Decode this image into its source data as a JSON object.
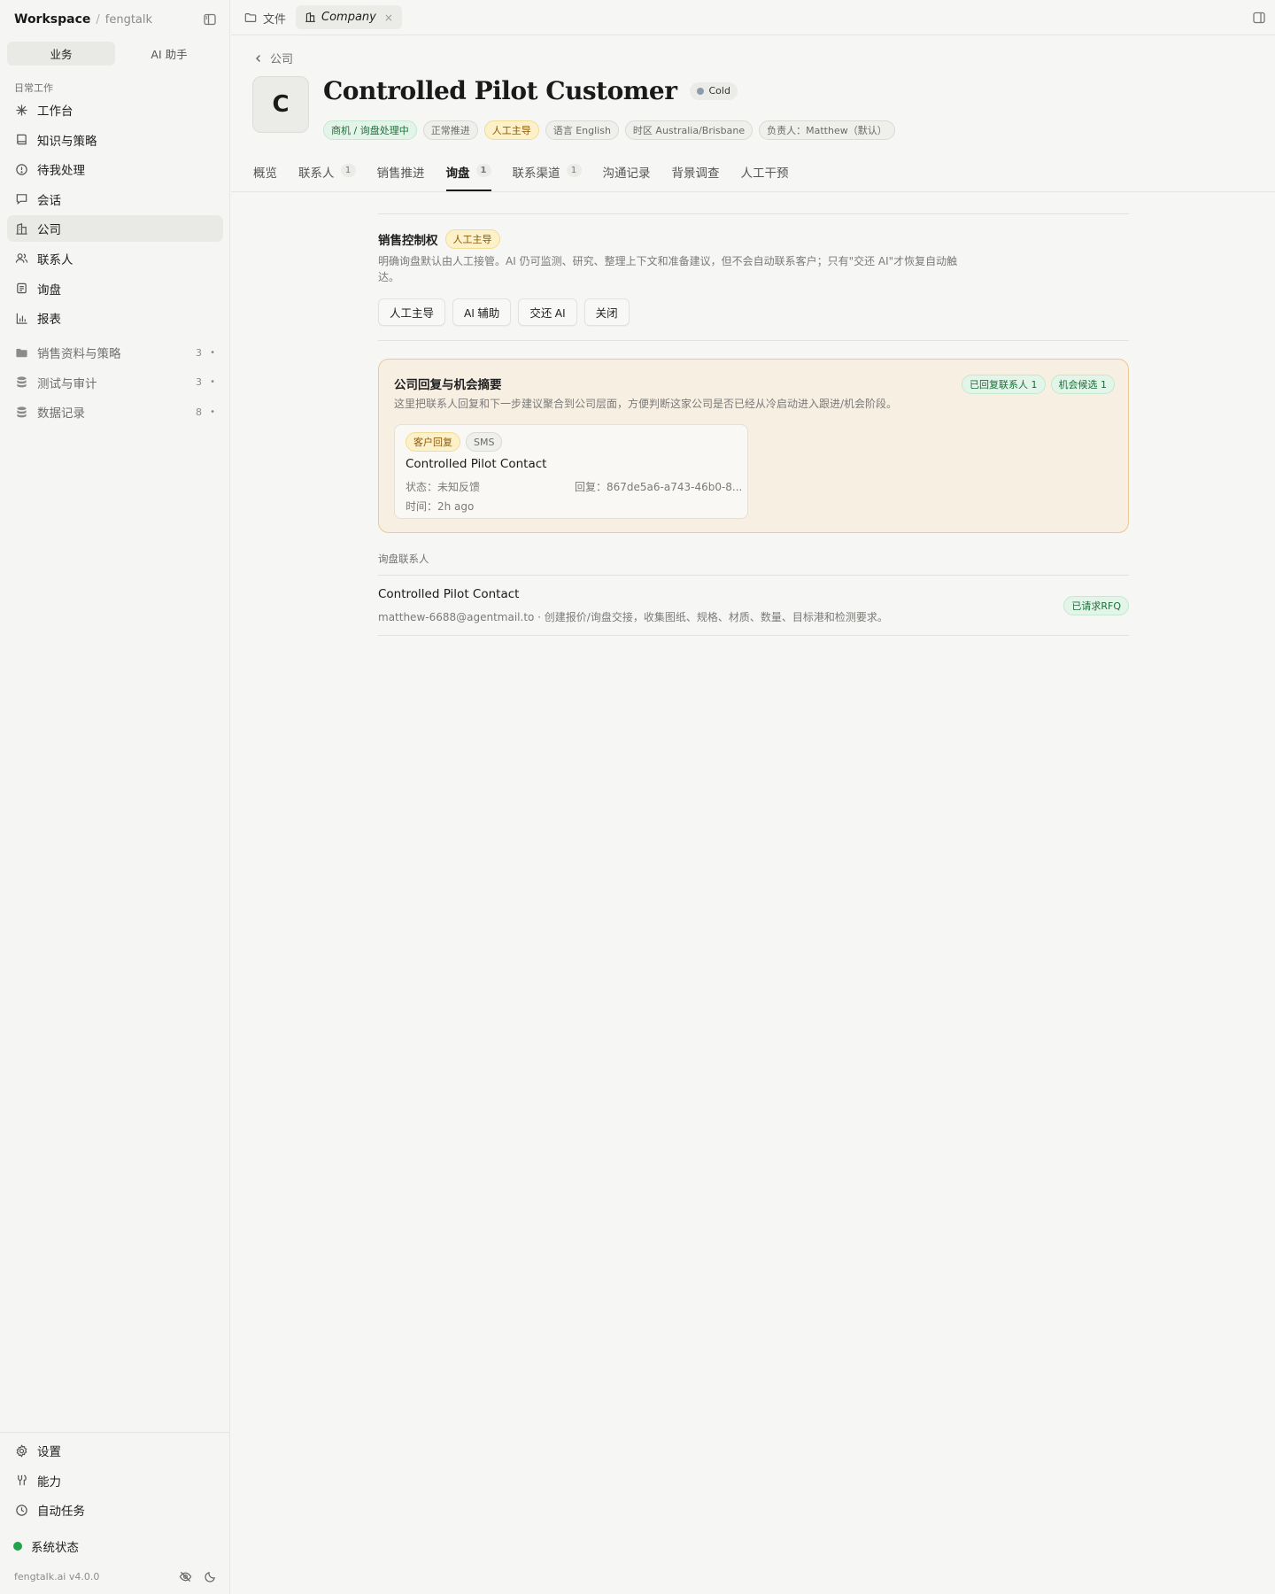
{
  "sidebar": {
    "workspace": "Workspace",
    "separator": "/",
    "org": "fengtalk",
    "segments": [
      "业务",
      "AI 助手"
    ],
    "section_label": "日常工作",
    "items": [
      {
        "label": "工作台",
        "icon": "sparkle-icon"
      },
      {
        "label": "知识与策略",
        "icon": "book-icon"
      },
      {
        "label": "待我处理",
        "icon": "alert-circle-icon"
      },
      {
        "label": "会话",
        "icon": "chat-icon"
      },
      {
        "label": "公司",
        "icon": "building-icon"
      },
      {
        "label": "联系人",
        "icon": "users-icon"
      },
      {
        "label": "询盘",
        "icon": "clipboard-icon"
      },
      {
        "label": "报表",
        "icon": "bar-chart-icon"
      }
    ],
    "folders": [
      {
        "label": "销售资料与策略",
        "count": "3",
        "icon": "folder-icon"
      },
      {
        "label": "测试与审计",
        "count": "3",
        "icon": "database-icon"
      },
      {
        "label": "数据记录",
        "count": "8",
        "icon": "database-icon"
      }
    ],
    "bottom": [
      {
        "label": "设置",
        "icon": "gear-icon"
      },
      {
        "label": "能力",
        "icon": "tools-icon"
      },
      {
        "label": "自动任务",
        "icon": "clock-icon"
      }
    ],
    "system_status": "系统状态",
    "version": "fengtalk.ai v4.0.0"
  },
  "topbar": {
    "files_tab": "文件",
    "company_tab": "Company",
    "close": "×"
  },
  "company": {
    "back": "公司",
    "avatar_letter": "C",
    "name": "Controlled Pilot Customer",
    "status": "Cold",
    "chips": [
      "商机 / 询盘处理中",
      "正常推进",
      "人工主导",
      "语言 English",
      "时区 Australia/Brisbane",
      "负责人：Matthew（默认）"
    ]
  },
  "tabs": [
    {
      "label": "概览",
      "count": ""
    },
    {
      "label": "联系人",
      "count": "1"
    },
    {
      "label": "销售推进",
      "count": ""
    },
    {
      "label": "询盘",
      "count": "1"
    },
    {
      "label": "联系渠道",
      "count": "1"
    },
    {
      "label": "沟通记录",
      "count": ""
    },
    {
      "label": "背景调查",
      "count": ""
    },
    {
      "label": "人工干预",
      "count": ""
    }
  ],
  "sales_control": {
    "title": "销售控制权",
    "badge": "人工主导",
    "description": "明确询盘默认由人工接管。AI 仍可监测、研究、整理上下文和准备建议，但不会自动联系客户；只有\"交还 AI\"才恢复自动触达。",
    "buttons": [
      "人工主导",
      "AI 辅助",
      "交还 AI",
      "关闭"
    ]
  },
  "summary": {
    "title": "公司回复与机会摘要",
    "description": "这里把联系人回复和下一步建议聚合到公司层面，方便判断这家公司是否已经从冷启动进入跟进/机会阶段。",
    "chips": [
      "已回复联系人 1",
      "机会候选 1"
    ],
    "reply": {
      "tags": [
        "客户回复",
        "SMS"
      ],
      "name": "Controlled Pilot Contact",
      "status": "状态：未知反馈",
      "reply_id": "回复：867de5a6-a743-46b0-8...",
      "time": "时间：2h ago"
    }
  },
  "inquiry_contacts": {
    "label": "询盘联系人",
    "name": "Controlled Pilot Contact",
    "description": "matthew-6688@agentmail.to · 创建报价/询盘交接，收集图纸、规格、材质、数量、目标港和检测要求。",
    "badge": "已请求RFQ"
  }
}
